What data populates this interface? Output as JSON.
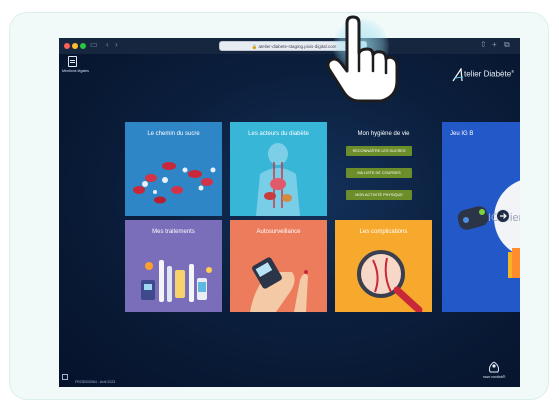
{
  "browser": {
    "url": "atelier-diabete-staging.pixis-digital.com",
    "back_glyph": "‹",
    "forward_glyph": "›",
    "sidebar_glyph": "▭",
    "share_glyph": "⇧",
    "new_tab_glyph": "+",
    "tabs_glyph": "⧉",
    "traffic_lights": [
      "#fe5f57",
      "#febc2e",
      "#28c840"
    ]
  },
  "app": {
    "documents_label": "Mentions légales",
    "brand_name": "telier Diabète",
    "brand_mark": "®",
    "footer_code": "FR23DI00064 - Avril 2023",
    "partner_label": "novo nordisk®"
  },
  "tiles": [
    {
      "key": "sucre",
      "title": "Le chemin du sucre",
      "color": "#2f86c6"
    },
    {
      "key": "acteurs",
      "title": "Les acteurs du diabète",
      "color": "#38b6d8"
    },
    {
      "key": "hygiene",
      "title": "Mon hygiène de vie",
      "color": "#0a1930"
    },
    {
      "key": "traitements",
      "title": "Mes traitements",
      "color": "#7a6db9"
    },
    {
      "key": "auto",
      "title": "Autosurveillance",
      "color": "#ec7c5c"
    },
    {
      "key": "complications",
      "title": "Les complications",
      "color": "#f6a92d"
    }
  ],
  "hygiene_buttons": [
    "RECONNAÎTRE LES SUCRES",
    "MA LISTE DE COURSES",
    "MON ACTIVITÉ PHYSIQUE"
  ],
  "game_tile": {
    "title": "Jeu IG B",
    "badge_text": "IG Bien",
    "color": "#2358c9"
  },
  "icons": [
    "document-icon",
    "brand-logo-icon",
    "arrow-right-icon",
    "external-link-icon",
    "novo-nordisk-logo-icon",
    "hand-pointer-icon",
    "lock-icon"
  ]
}
